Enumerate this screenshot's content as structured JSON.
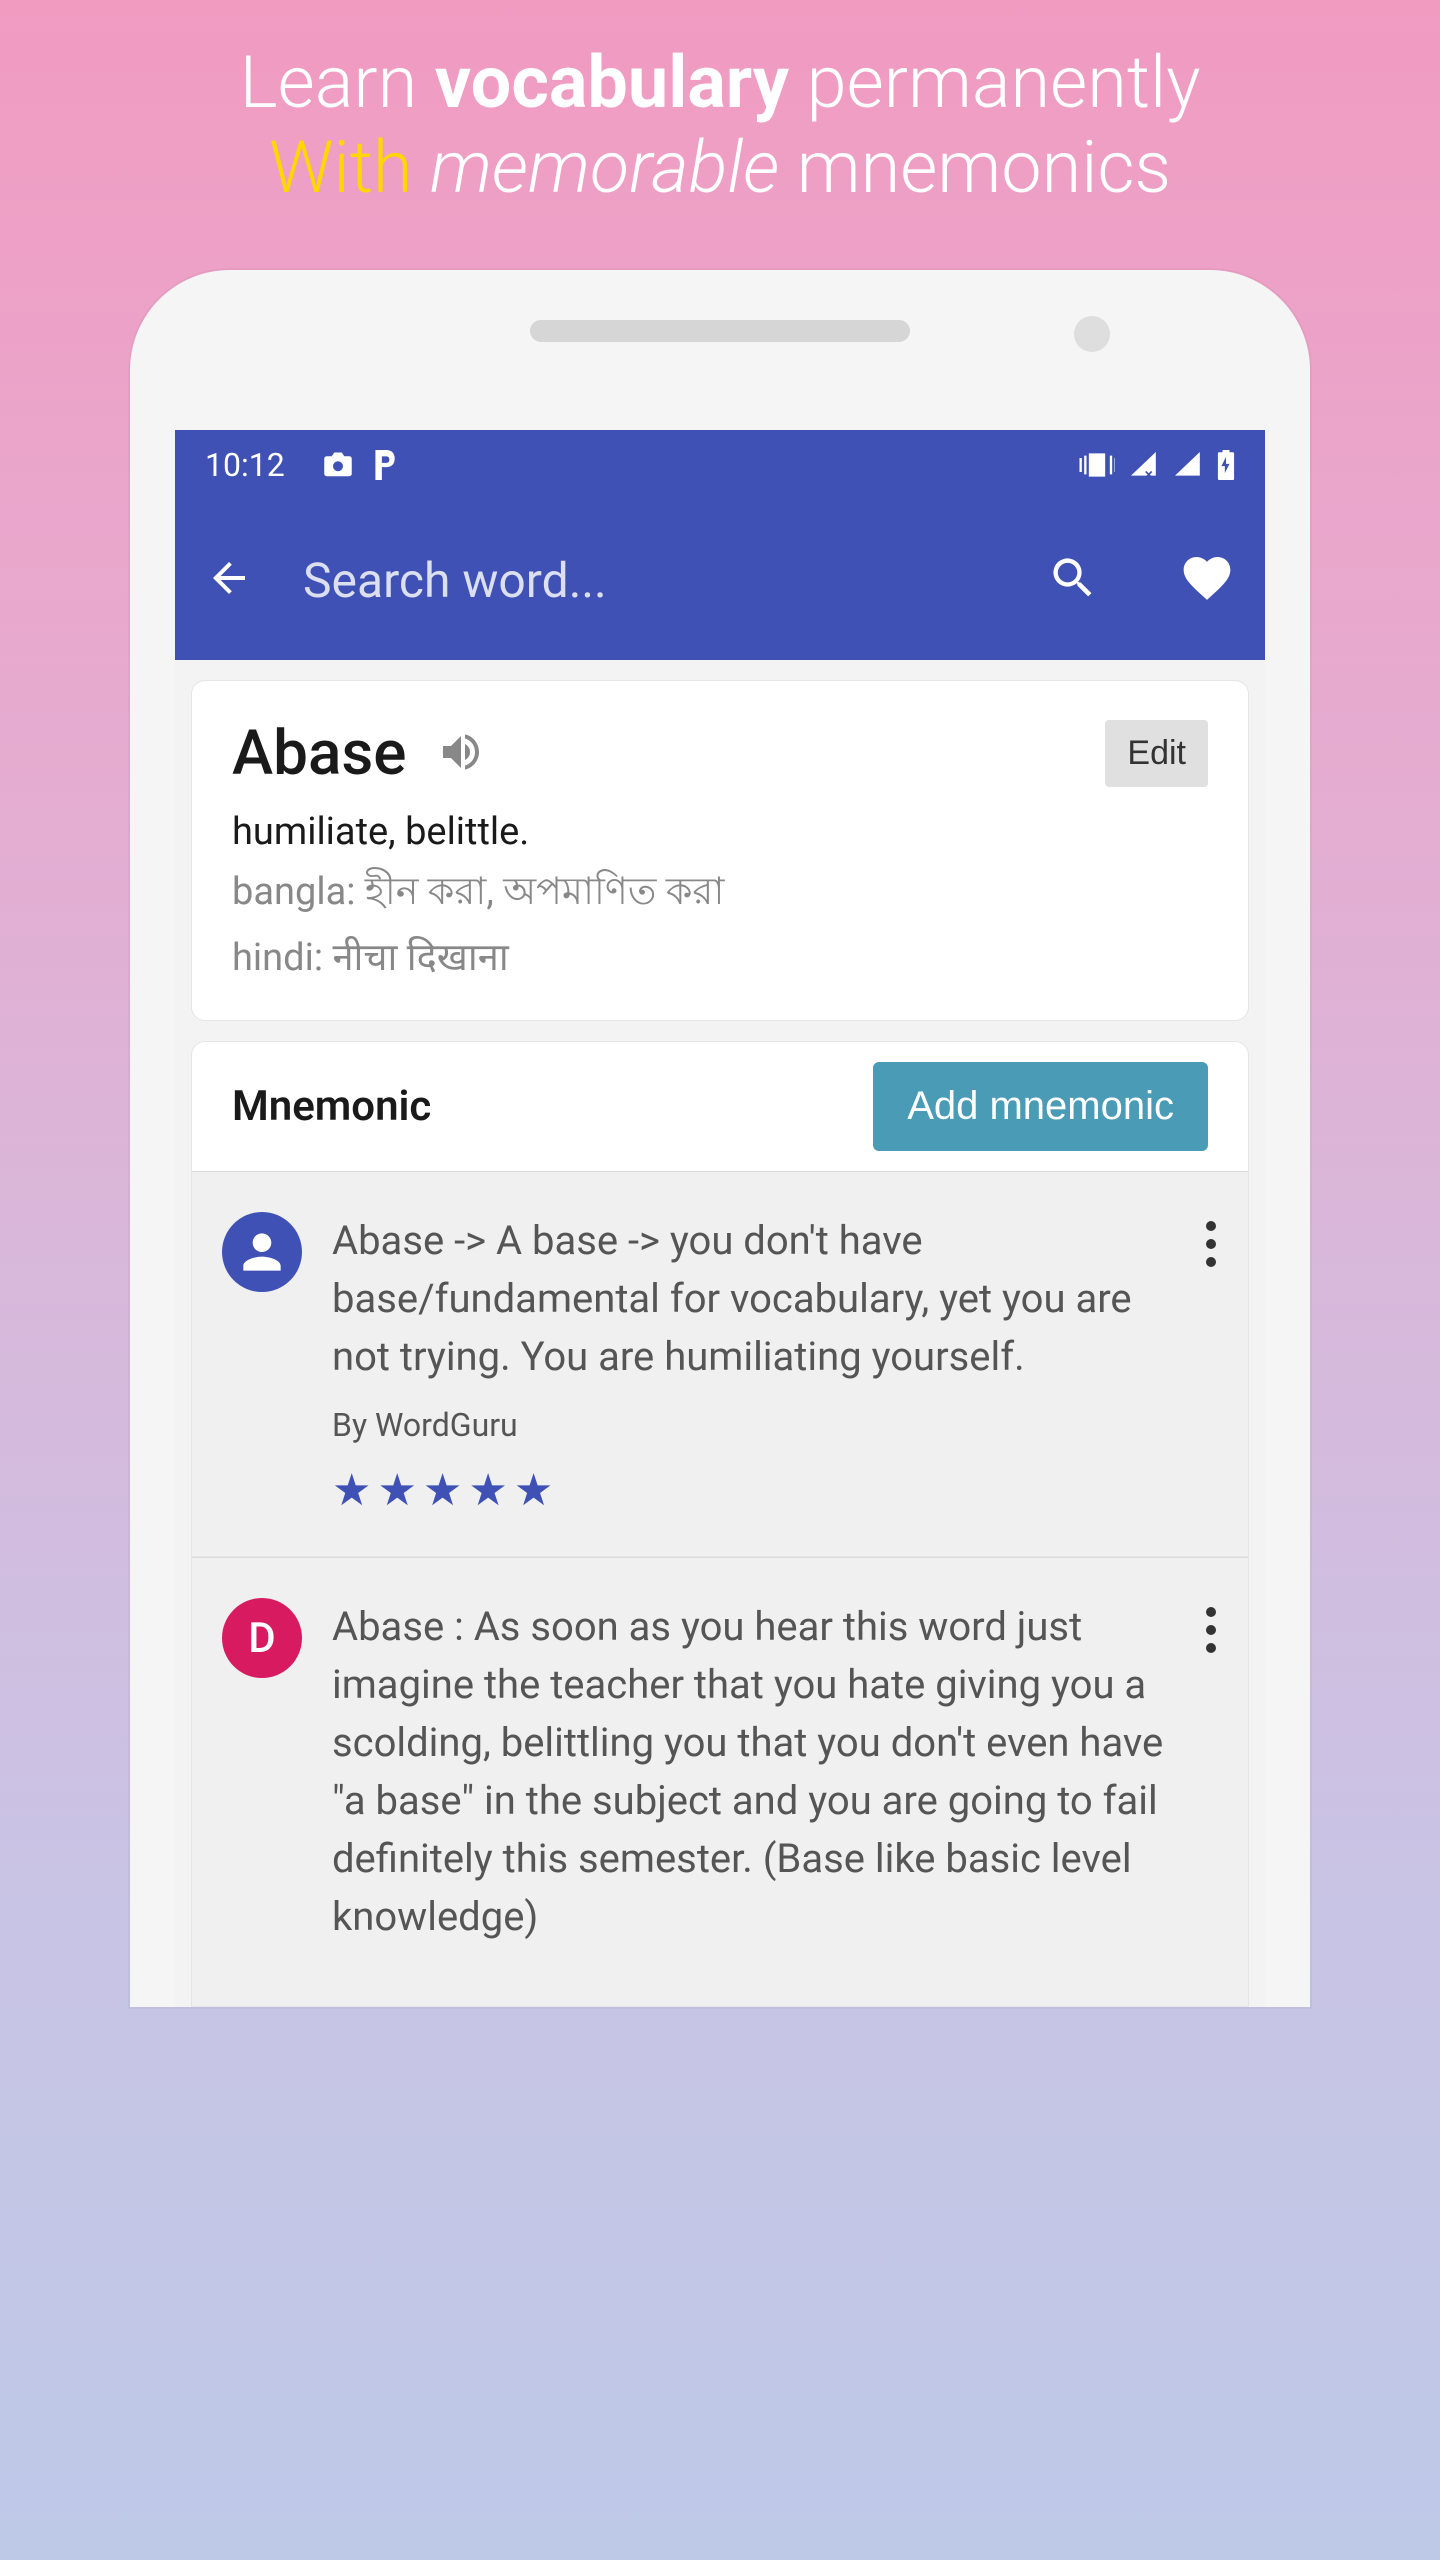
{
  "promo": {
    "line1_part1": "Learn ",
    "line1_bold": "vocabulary",
    "line1_part2": " permanently",
    "line2_yellow": "With ",
    "line2_italic": "memorable",
    "line2_rest": " mnemonics"
  },
  "status": {
    "time": "10:12"
  },
  "appbar": {
    "search_placeholder": "Search word..."
  },
  "word": {
    "title": "Abase",
    "edit_label": "Edit",
    "definition": "humiliate, belittle.",
    "translation_bangla": "bangla: হীন করা, অপমাণিত করা",
    "translation_hindi": "hindi: नीचा दिखाना"
  },
  "mnemonic_section": {
    "title": "Mnemonic",
    "add_label": "Add mnemonic"
  },
  "mnemonics": [
    {
      "avatar_letter": "",
      "text": "Abase -> A base -> you don't have base/fundamental for vocabulary, yet you are not trying. You are humiliating yourself.",
      "author": "By WordGuru",
      "stars": 5
    },
    {
      "avatar_letter": "D",
      "text": "Abase : As soon as you hear this word just imagine the teacher that you hate giving you a scolding, belittling you that you don't even have \"a base\" in the subject and you are going to fail definitely this semester. (Base like basic level knowledge)",
      "author": ""
    }
  ]
}
